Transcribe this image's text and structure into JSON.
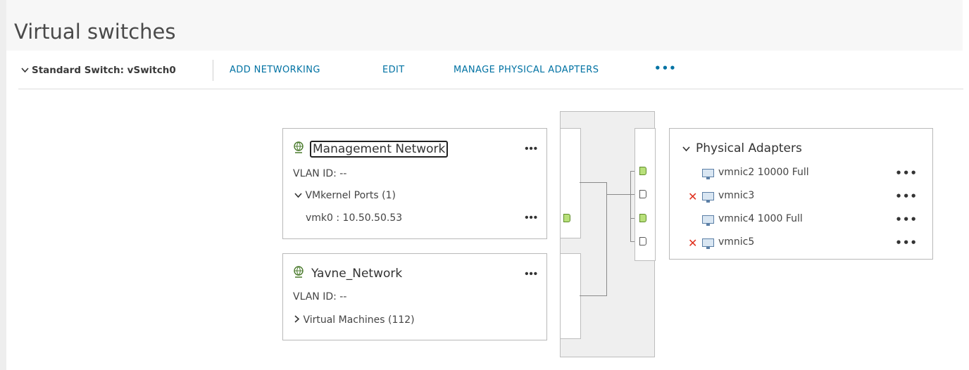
{
  "page": {
    "title": "Virtual switches"
  },
  "toolbar": {
    "switch_label": "Standard Switch: vSwitch0",
    "add_networking": "ADD NETWORKING",
    "edit": "EDIT",
    "manage_adapters": "MANAGE PHYSICAL ADAPTERS",
    "more": "•••"
  },
  "port_groups": [
    {
      "name": "Management Network",
      "vlan": "VLAN ID: --",
      "section": "VMkernel Ports (1)",
      "section_expanded": true,
      "items": [
        "vmk0 : 10.50.50.53"
      ]
    },
    {
      "name": "Yavne_Network",
      "vlan": "VLAN ID: --",
      "section": "Virtual Machines (112)",
      "section_expanded": false,
      "items": []
    }
  ],
  "physical_adapters": {
    "title": "Physical Adapters",
    "adapters": [
      {
        "name": "vmnic2 10000 Full",
        "disconnected": false
      },
      {
        "name": "vmnic3",
        "disconnected": true
      },
      {
        "name": "vmnic4 1000 Full",
        "disconnected": false
      },
      {
        "name": "vmnic5",
        "disconnected": true
      }
    ]
  },
  "icons": {
    "expanded": "chevron-down-icon",
    "collapsed": "chevron-right-icon",
    "network": "network-globe-icon",
    "adapter": "physical-nic-icon",
    "error": "disconnected-x-icon",
    "more": "ellipsis-icon"
  },
  "colors": {
    "link": "#0072a3",
    "error": "#e0301e",
    "port_active": "#b8e07a"
  }
}
